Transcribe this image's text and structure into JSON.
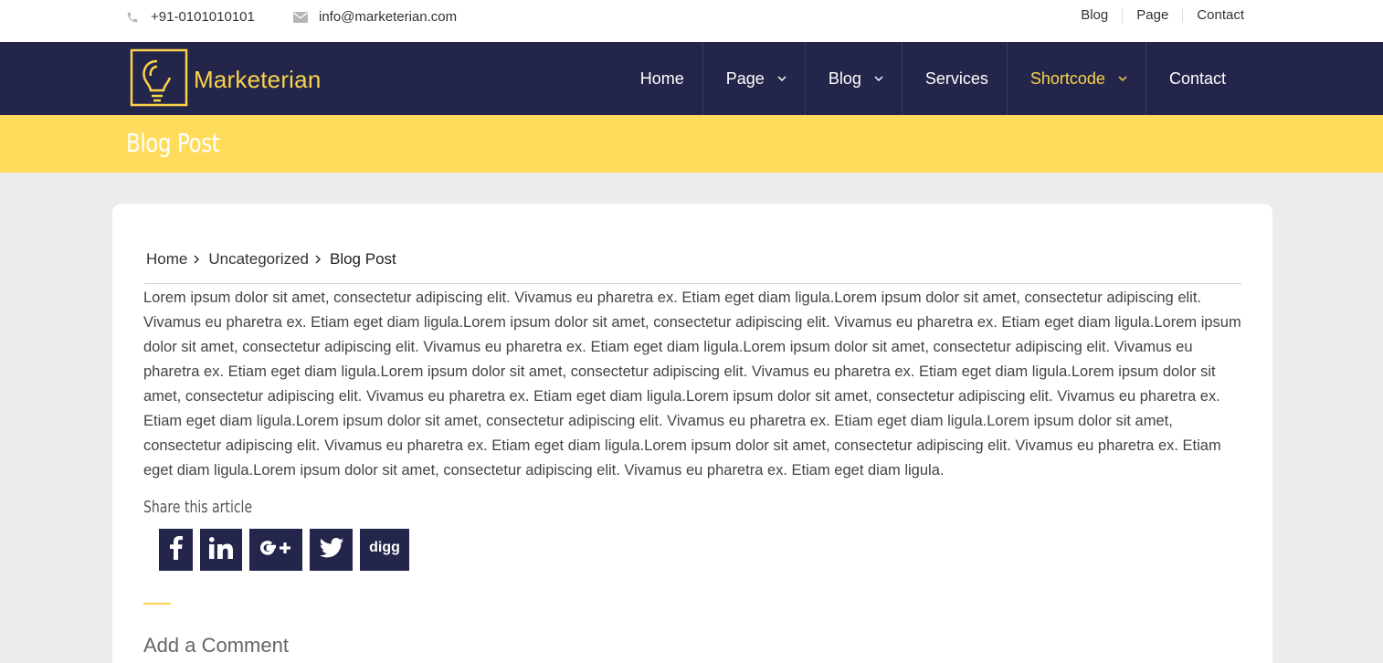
{
  "topbar": {
    "phone": "+91-0101010101",
    "email": "info@marketerian.com",
    "links": [
      "Blog",
      "Page",
      "Contact"
    ]
  },
  "brand": {
    "name": "Marketerian",
    "color": "#fbd349"
  },
  "nav": {
    "items": [
      {
        "label": "Home",
        "has_dropdown": false,
        "active": false
      },
      {
        "label": "Page",
        "has_dropdown": true,
        "active": false
      },
      {
        "label": "Blog",
        "has_dropdown": true,
        "active": false
      },
      {
        "label": "Services",
        "has_dropdown": false,
        "active": false
      },
      {
        "label": "Shortcode",
        "has_dropdown": true,
        "active": true
      },
      {
        "label": "Contact",
        "has_dropdown": false,
        "active": false
      }
    ]
  },
  "page": {
    "title": "Blog Post"
  },
  "breadcrumb": {
    "items": [
      "Home",
      "Uncategorized",
      "Blog Post"
    ]
  },
  "article": {
    "body": "Lorem ipsum dolor sit amet, consectetur adipiscing elit. Vivamus eu pharetra ex. Etiam eget diam ligula.Lorem ipsum dolor sit amet, consectetur adipiscing elit. Vivamus eu pharetra ex. Etiam eget diam ligula.Lorem ipsum dolor sit amet, consectetur adipiscing elit. Vivamus eu pharetra ex. Etiam eget diam ligula.Lorem ipsum dolor sit amet, consectetur adipiscing elit. Vivamus eu pharetra ex. Etiam eget diam ligula.Lorem ipsum dolor sit amet, consectetur adipiscing elit. Vivamus eu pharetra ex. Etiam eget diam ligula.Lorem ipsum dolor sit amet, consectetur adipiscing elit. Vivamus eu pharetra ex. Etiam eget diam ligula.Lorem ipsum dolor sit amet, consectetur adipiscing elit. Vivamus eu pharetra ex. Etiam eget diam ligula.Lorem ipsum dolor sit amet, consectetur adipiscing elit. Vivamus eu pharetra ex. Etiam eget diam ligula.Lorem ipsum dolor sit amet, consectetur adipiscing elit. Vivamus eu pharetra ex. Etiam eget diam ligula.Lorem ipsum dolor sit amet, consectetur adipiscing elit. Vivamus eu pharetra ex. Etiam eget diam ligula.Lorem ipsum dolor sit amet, consectetur adipiscing elit. Vivamus eu pharetra ex. Etiam eget diam ligula.Lorem ipsum dolor sit amet, consectetur adipiscing elit. Vivamus eu pharetra ex. Etiam eget diam ligula."
  },
  "share": {
    "title": "Share this article",
    "buttons": [
      {
        "name": "facebook",
        "icon": "facebook-icon"
      },
      {
        "name": "linkedin",
        "icon": "linkedin-icon"
      },
      {
        "name": "google-plus",
        "icon": "google-plus-icon"
      },
      {
        "name": "twitter",
        "icon": "twitter-icon"
      },
      {
        "name": "digg",
        "icon": "digg-icon",
        "text": "digg"
      }
    ]
  },
  "comments": {
    "title": "Add a Comment"
  },
  "colors": {
    "navy": "#23254a",
    "yellow": "#ffdc5b",
    "accent": "#fbd349"
  }
}
